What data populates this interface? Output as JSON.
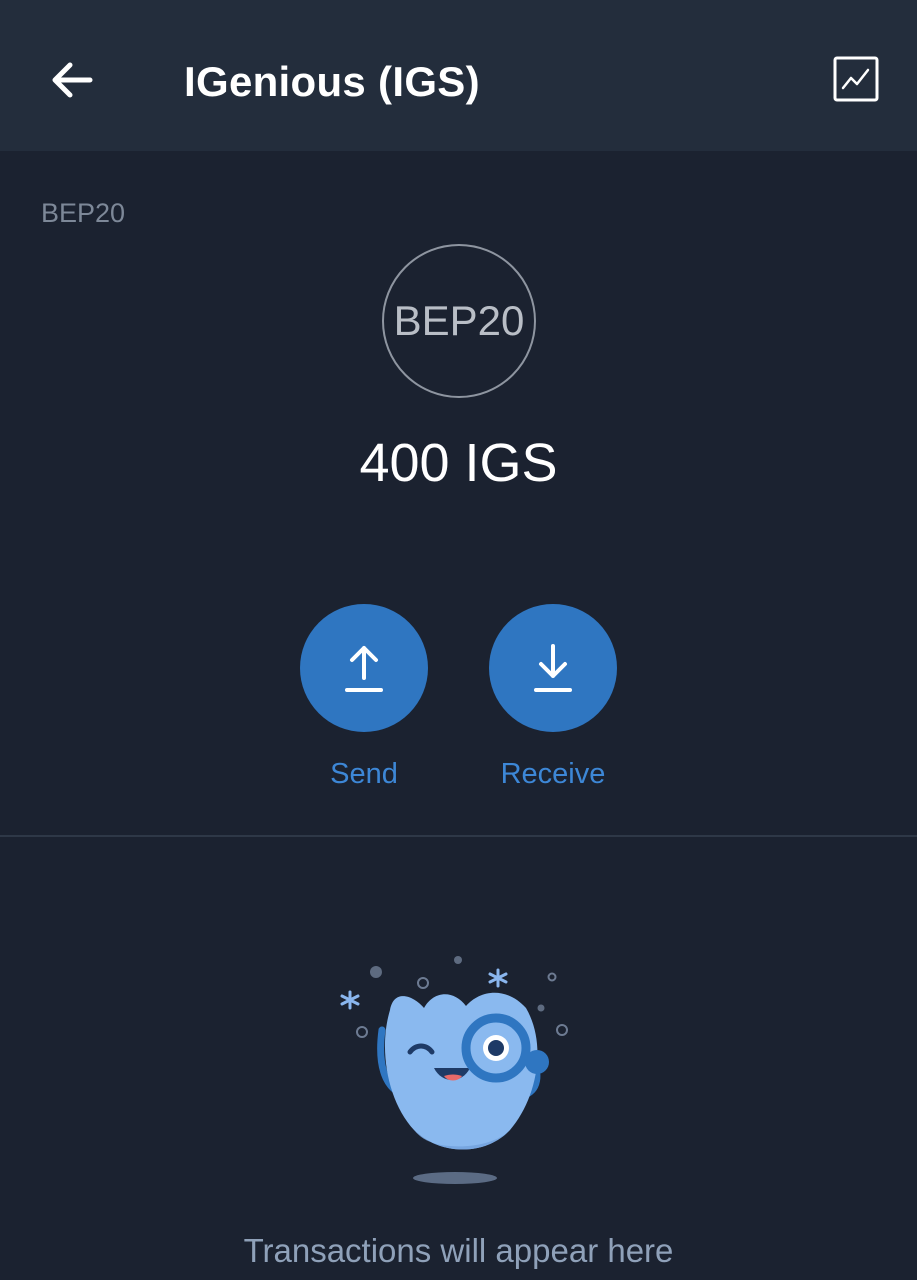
{
  "header": {
    "title": "IGenious (IGS)",
    "back_icon": "arrow-left-icon",
    "chart_icon": "line-chart-icon"
  },
  "token": {
    "network": "BEP20",
    "logo_text": "BEP20",
    "balance": "400 IGS"
  },
  "actions": {
    "send_label": "Send",
    "receive_label": "Receive"
  },
  "transactions": {
    "empty_message": "Transactions will appear here"
  },
  "colors": {
    "background": "#1b2230",
    "header_background": "#232d3c",
    "accent": "#2f76c1",
    "accent_text": "#3d87d6",
    "muted_text": "#7d8898"
  }
}
